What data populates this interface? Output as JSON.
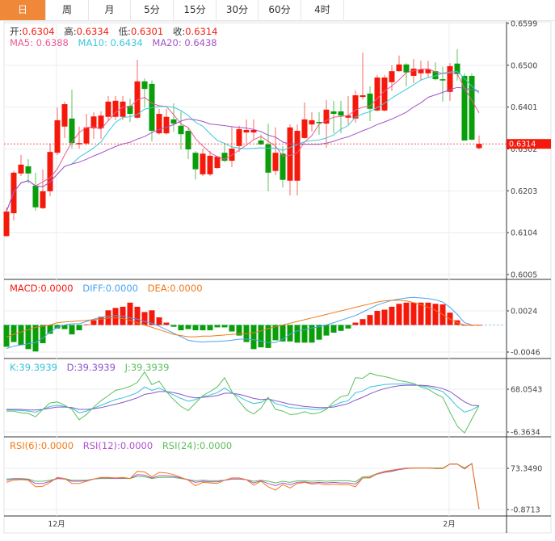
{
  "tabs": [
    {
      "label": "日",
      "active": true
    },
    {
      "label": "周"
    },
    {
      "label": "月"
    },
    {
      "label": "5分"
    },
    {
      "label": "15分"
    },
    {
      "label": "30分"
    },
    {
      "label": "60分"
    },
    {
      "label": "4时"
    }
  ],
  "ohlc_legend": {
    "open_label": "开:",
    "open": "0.6304",
    "high_label": "高:",
    "high": "0.6334",
    "low_label": "低:",
    "low": "0.6301",
    "close_label": "收:",
    "close": "0.6314"
  },
  "ma_legend": {
    "ma5": "MA5: 0.6388",
    "ma10": "MA10: 0.6434",
    "ma20": "MA20: 0.6438"
  },
  "macd_legend": {
    "macd": "MACD:0.0000",
    "diff": "DIFF:0.0000",
    "dea": "DEA:0.0000"
  },
  "kdj_legend": {
    "k": "K:39.3939",
    "d": "D:39.3939",
    "j": "J:39.3939"
  },
  "rsi_legend": {
    "rsi6": "RSI(6):0.0000",
    "rsi12": "RSI(12):0.0000",
    "rsi24": "RSI(24):0.0000"
  },
  "colors": {
    "up": "#f5190c",
    "down": "#0a9e0a",
    "ma5": "#ec5a92",
    "ma10": "#3cc8dc",
    "ma20": "#a452c8",
    "accent": "#f0883a",
    "diff": "#4aa3f0",
    "dea": "#f07a1a",
    "k": "#35c3dd",
    "d": "#8a55cc",
    "j": "#5cbf5c",
    "rsi6": "#f07a1a",
    "rsi12": "#b050d0",
    "rsi24": "#5cbf5c"
  },
  "chart_data": [
    {
      "type": "candlestick",
      "price_axis_ticks": [
        "0.6599",
        "0.6500",
        "0.6401",
        "0.6302",
        "0.6203",
        "0.6104",
        "0.6005"
      ],
      "ylim": [
        0.6005,
        0.6599
      ],
      "x_tick_labels": [
        {
          "label": "12月",
          "index": 7
        },
        {
          "label": "2月",
          "index": 61
        }
      ],
      "current_price": "0.6314",
      "candles": [
        [
          0.6096,
          0.6164,
          0.6094,
          0.6154
        ],
        [
          0.615,
          0.625,
          0.6133,
          0.6246
        ],
        [
          0.6244,
          0.6288,
          0.6238,
          0.6265
        ],
        [
          0.6261,
          0.6278,
          0.6221,
          0.6244
        ],
        [
          0.6215,
          0.6246,
          0.6156,
          0.6164
        ],
        [
          0.6162,
          0.6254,
          0.616,
          0.6202
        ],
        [
          0.6202,
          0.6315,
          0.619,
          0.6295
        ],
        [
          0.6293,
          0.64,
          0.6288,
          0.637
        ],
        [
          0.6355,
          0.6414,
          0.6328,
          0.6408
        ],
        [
          0.6374,
          0.6442,
          0.6303,
          0.6316
        ],
        [
          0.6313,
          0.6355,
          0.6303,
          0.6316
        ],
        [
          0.6315,
          0.6385,
          0.6311,
          0.6353
        ],
        [
          0.6351,
          0.6389,
          0.6326,
          0.6379
        ],
        [
          0.6351,
          0.6391,
          0.6326,
          0.6381
        ],
        [
          0.6378,
          0.6427,
          0.6368,
          0.6414
        ],
        [
          0.6378,
          0.6427,
          0.637,
          0.6416
        ],
        [
          0.6378,
          0.6427,
          0.637,
          0.6414
        ],
        [
          0.6404,
          0.6421,
          0.6366,
          0.6385
        ],
        [
          0.6376,
          0.6513,
          0.6374,
          0.6462
        ],
        [
          0.6462,
          0.6469,
          0.64,
          0.6444
        ],
        [
          0.6456,
          0.6464,
          0.632,
          0.6345
        ],
        [
          0.6339,
          0.6397,
          0.6336,
          0.6385
        ],
        [
          0.6339,
          0.6397,
          0.6336,
          0.6378
        ],
        [
          0.6372,
          0.641,
          0.6343,
          0.6362
        ],
        [
          0.6357,
          0.6391,
          0.6301,
          0.6337
        ],
        [
          0.6345,
          0.6351,
          0.6278,
          0.6301
        ],
        [
          0.6293,
          0.6297,
          0.623,
          0.6254
        ],
        [
          0.6242,
          0.6303,
          0.6238,
          0.6291
        ],
        [
          0.6242,
          0.6297,
          0.6238,
          0.6286
        ],
        [
          0.6257,
          0.6286,
          0.6255,
          0.6284
        ],
        [
          0.6293,
          0.6316,
          0.6271,
          0.6274
        ],
        [
          0.6274,
          0.6355,
          0.6259,
          0.6303
        ],
        [
          0.6309,
          0.6357,
          0.6295,
          0.6349
        ],
        [
          0.6341,
          0.6372,
          0.6315,
          0.6347
        ],
        [
          0.6341,
          0.6372,
          0.6324,
          0.6347
        ],
        [
          0.6322,
          0.6336,
          0.6311,
          0.6313
        ],
        [
          0.6313,
          0.6362,
          0.6202,
          0.6246
        ],
        [
          0.625,
          0.6353,
          0.624,
          0.6293
        ],
        [
          0.6291,
          0.6309,
          0.6211,
          0.6229
        ],
        [
          0.6227,
          0.636,
          0.6192,
          0.6353
        ],
        [
          0.6227,
          0.636,
          0.6192,
          0.6345
        ],
        [
          0.6328,
          0.6412,
          0.6326,
          0.6372
        ],
        [
          0.636,
          0.6389,
          0.6343,
          0.637
        ],
        [
          0.6366,
          0.6389,
          0.6336,
          0.6364
        ],
        [
          0.6362,
          0.6418,
          0.6305,
          0.6395
        ],
        [
          0.6391,
          0.6416,
          0.6339,
          0.6385
        ],
        [
          0.6391,
          0.6416,
          0.6339,
          0.6381
        ],
        [
          0.6376,
          0.6427,
          0.636,
          0.6381
        ],
        [
          0.6374,
          0.6441,
          0.6364,
          0.6429
        ],
        [
          0.6425,
          0.653,
          0.6419,
          0.6429
        ],
        [
          0.6433,
          0.645,
          0.6368,
          0.6397
        ],
        [
          0.6393,
          0.6477,
          0.6391,
          0.6471
        ],
        [
          0.6393,
          0.6477,
          0.6391,
          0.6471
        ],
        [
          0.646,
          0.65,
          0.6439,
          0.6486
        ],
        [
          0.6486,
          0.6523,
          0.6485,
          0.6502
        ],
        [
          0.6502,
          0.6505,
          0.645,
          0.6483
        ],
        [
          0.6475,
          0.6515,
          0.6458,
          0.6492
        ],
        [
          0.6481,
          0.6511,
          0.6464,
          0.649
        ],
        [
          0.6481,
          0.6511,
          0.6471,
          0.649
        ],
        [
          0.6486,
          0.6507,
          0.6464,
          0.6467
        ],
        [
          0.6467,
          0.6496,
          0.6414,
          0.6464
        ],
        [
          0.6437,
          0.6505,
          0.6416,
          0.6498
        ],
        [
          0.6504,
          0.6538,
          0.6464,
          0.6479
        ],
        [
          0.6475,
          0.6481,
          0.6322,
          0.6322
        ],
        [
          0.6475,
          0.6481,
          0.6322,
          0.6324
        ],
        [
          0.6304,
          0.6334,
          0.6301,
          0.6314
        ]
      ],
      "candle_format": [
        "open",
        "high",
        "low",
        "close"
      ],
      "overlays": [
        "MA5",
        "MA10",
        "MA20"
      ]
    },
    {
      "type": "bar+line",
      "name": "MACD",
      "axis_ticks": [
        "0.0024",
        "-0.0046"
      ],
      "histogram": [
        -0.0037,
        -0.0029,
        -0.0034,
        -0.0041,
        -0.0045,
        -0.0031,
        -0.0015,
        -0.0006,
        -0.0007,
        -0.0016,
        -0.0009,
        0.0001,
        0.0008,
        0.0014,
        0.0025,
        0.0029,
        0.0031,
        0.0038,
        0.0031,
        0.0022,
        0.0025,
        0.0013,
        0.0004,
        -0.0003,
        -0.0009,
        -0.0007,
        -0.0009,
        -0.0009,
        -0.0009,
        -0.0004,
        -0.0004,
        -0.0011,
        -0.0018,
        -0.0029,
        -0.0041,
        -0.0038,
        -0.0039,
        -0.0026,
        -0.0028,
        -0.0028,
        -0.003,
        -0.003,
        -0.003,
        -0.0025,
        -0.0018,
        -0.0013,
        -0.001,
        -0.0006,
        0.0004,
        0.001,
        0.0017,
        0.0024,
        0.0026,
        0.0031,
        0.0036,
        0.0038,
        0.0038,
        0.0038,
        0.0038,
        0.0036,
        0.0035,
        0.0021,
        0.0008,
        0,
        0,
        0
      ],
      "diff": [
        -0.004,
        -0.0036,
        -0.0034,
        -0.0032,
        -0.003,
        -0.0022,
        -0.0012,
        -0.0004,
        0.0,
        0.0002,
        0.0002,
        0.0006,
        0.001,
        0.0013,
        0.0015,
        0.0016,
        0.0015,
        0.0012,
        0.001,
        0.0006,
        0.0003,
        -0.0002,
        -0.0008,
        -0.0014,
        -0.002,
        -0.0026,
        -0.0028,
        -0.0029,
        -0.0028,
        -0.0028,
        -0.0027,
        -0.0026,
        -0.0024,
        -0.0024,
        -0.0025,
        -0.0027,
        -0.003,
        -0.003,
        -0.0024,
        -0.0016,
        -0.001,
        -0.0008,
        -0.0005,
        -0.0003,
        0.0,
        0.0004,
        0.0008,
        0.0012,
        0.0016,
        0.0022,
        0.0028,
        0.0034,
        0.0038,
        0.0042,
        0.0044,
        0.0046,
        0.0047,
        0.0046,
        0.0045,
        0.0043,
        0.0039,
        0.003,
        0.0018,
        0.0004,
        0.0,
        0.0
      ],
      "dea": [
        -0.002,
        -0.0016,
        -0.0012,
        -0.0008,
        -0.0004,
        -0.0002,
        0.0,
        0.0004,
        0.0005,
        0.0006,
        0.0007,
        0.0008,
        0.0009,
        0.001,
        0.0012,
        0.0012,
        0.0011,
        0.0008,
        0.0004,
        0.0,
        -0.0004,
        -0.0008,
        -0.0012,
        -0.0016,
        -0.0018,
        -0.002,
        -0.002,
        -0.0019,
        -0.0019,
        -0.0018,
        -0.0017,
        -0.0016,
        -0.0015,
        -0.0015,
        -0.0013,
        -0.001,
        -0.0006,
        -0.0003,
        0.0,
        0.0003,
        0.0006,
        0.0009,
        0.0012,
        0.0015,
        0.0018,
        0.0021,
        0.0024,
        0.0027,
        0.003,
        0.0033,
        0.0036,
        0.0039,
        0.0041,
        0.0042,
        0.0042,
        0.0041,
        0.0038,
        0.0034,
        0.003,
        0.0025,
        0.0018,
        0.001,
        0.0004,
        0.0,
        0.0,
        0.0
      ]
    },
    {
      "type": "line",
      "name": "KDJ",
      "axis_ticks": [
        "68.0543",
        "-6.3634"
      ],
      "k": [
        32,
        32,
        31,
        30,
        28,
        33,
        38,
        40,
        38,
        35,
        27,
        30,
        35,
        40,
        45,
        50,
        53,
        57,
        62,
        72,
        66,
        70,
        64,
        58,
        52,
        47,
        50,
        55,
        58,
        62,
        70,
        62,
        55,
        48,
        43,
        45,
        52,
        43,
        40,
        36,
        35,
        35,
        33,
        33,
        35,
        40,
        45,
        48,
        62,
        65,
        72,
        74,
        76,
        77,
        77,
        77,
        76,
        74,
        72,
        68,
        64,
        52,
        38,
        28,
        32,
        39.39
      ],
      "d": [
        33,
        33,
        33,
        32,
        32,
        33,
        35,
        37,
        37,
        36,
        33,
        33,
        34,
        36,
        39,
        42,
        45,
        49,
        53,
        59,
        61,
        64,
        64,
        62,
        59,
        55,
        53,
        54,
        55,
        57,
        61,
        61,
        59,
        56,
        52,
        50,
        51,
        48,
        45,
        42,
        40,
        38,
        37,
        36,
        36,
        37,
        40,
        43,
        49,
        54,
        60,
        65,
        69,
        72,
        74,
        75,
        75,
        75,
        74,
        72,
        69,
        64,
        55,
        46,
        40,
        39.39
      ],
      "j": [
        30,
        30,
        27,
        26,
        20,
        33,
        44,
        46,
        40,
        33,
        15,
        24,
        37,
        48,
        57,
        66,
        69,
        73,
        80,
        98,
        76,
        82,
        64,
        50,
        38,
        31,
        44,
        57,
        64,
        72,
        88,
        64,
        47,
        32,
        25,
        35,
        54,
        33,
        30,
        24,
        25,
        29,
        25,
        27,
        33,
        46,
        55,
        58,
        88,
        87,
        96,
        92,
        90,
        87,
        83,
        81,
        78,
        72,
        68,
        60,
        54,
        28,
        4,
        -8,
        16,
        39.39
      ]
    },
    {
      "type": "line",
      "name": "RSI",
      "axis_ticks": [
        "73.3490",
        "-0.8713"
      ],
      "rsi6": [
        48,
        52,
        53,
        52,
        40,
        41,
        48,
        57,
        55,
        46,
        46,
        50,
        54,
        57,
        57,
        56,
        57,
        55,
        68,
        67,
        58,
        66,
        65,
        62,
        57,
        52,
        42,
        48,
        47,
        46,
        52,
        56,
        56,
        53,
        43,
        50,
        40,
        34,
        44,
        38,
        46,
        48,
        45,
        46,
        44,
        45,
        44,
        44,
        40,
        56,
        56,
        64,
        68,
        70,
        72,
        74,
        74,
        74,
        74,
        73,
        73,
        81,
        81,
        72,
        82,
        0
      ],
      "rsi12": [
        52,
        54,
        54,
        53,
        46,
        46,
        50,
        55,
        54,
        50,
        50,
        51,
        54,
        56,
        56,
        55,
        56,
        55,
        62,
        61,
        56,
        60,
        60,
        59,
        56,
        53,
        48,
        50,
        49,
        49,
        52,
        54,
        54,
        53,
        47,
        51,
        46,
        42,
        47,
        44,
        48,
        49,
        47,
        48,
        47,
        48,
        47,
        47,
        45,
        56,
        57,
        63,
        66,
        68,
        71,
        73,
        74,
        74,
        74,
        73,
        73,
        81,
        81,
        73,
        82,
        0
      ],
      "rsi24": [
        54,
        55,
        55,
        54,
        50,
        50,
        52,
        55,
        55,
        52,
        52,
        52,
        54,
        55,
        55,
        55,
        55,
        55,
        59,
        58,
        55,
        57,
        57,
        57,
        55,
        53,
        51,
        52,
        51,
        51,
        52,
        54,
        54,
        53,
        50,
        52,
        50,
        47,
        50,
        48,
        51,
        51,
        50,
        51,
        50,
        51,
        51,
        51,
        49,
        58,
        59,
        64,
        67,
        69,
        71,
        73,
        74,
        74,
        74,
        74,
        74,
        81,
        81,
        74,
        82,
        0
      ]
    }
  ]
}
